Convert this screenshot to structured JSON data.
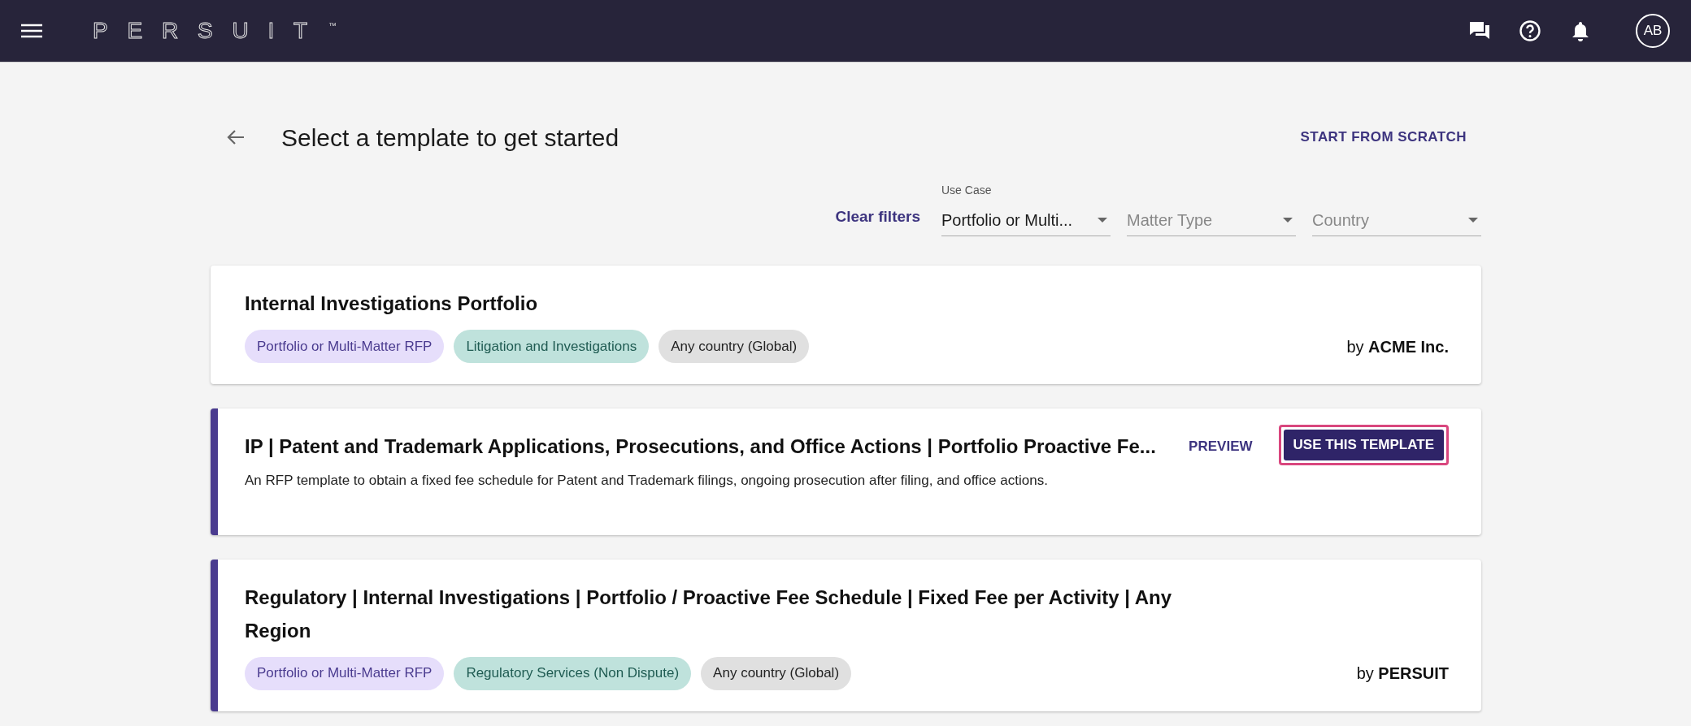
{
  "header": {
    "logo": "PERSUIT",
    "logo_mark": "™",
    "avatar": "AB"
  },
  "page": {
    "title": "Select a template to get started",
    "start_button": "START FROM SCRATCH"
  },
  "filters": {
    "clear": "Clear filters",
    "fields": [
      {
        "label": "Use Case",
        "value": "Portfolio or Multi..."
      },
      {
        "placeholder": "Matter Type"
      },
      {
        "placeholder": "Country"
      }
    ]
  },
  "templates": [
    {
      "title": "Internal Investigations Portfolio",
      "accent": false,
      "tags": [
        {
          "label": "Portfolio or Multi-Matter RFP",
          "kind": "use_case",
          "color": "#e6defb"
        },
        {
          "label": "Litigation and Investigations",
          "kind": "practice",
          "color": "#bfe2dc"
        },
        {
          "label": "Any country (Global)",
          "kind": "country",
          "color": "#e0e0e0"
        }
      ],
      "author": "by **ACME Inc.**"
    },
    {
      "title": "IP | Patent and Trademark Applications, Prosecutions, and Office Actions | Portfolio Proactive Fe...",
      "accent": true,
      "description": "An RFP template to obtain a fixed fee schedule for Patent and Trademark filings, ongoing prosecution after filing, and office actions.",
      "preview": "PREVIEW",
      "use": "USE THIS TEMPLATE",
      "focused": true
    },
    {
      "title": "Regulatory | Internal Investigations | Portfolio / Proactive Fee Schedule | Fixed Fee per Activity | Any Region",
      "accent": true,
      "tags": [
        {
          "label": "Portfolio or Multi-Matter RFP",
          "kind": "use_case",
          "color": "#e6defb"
        },
        {
          "label": "Regulatory Services (Non Dispute)",
          "kind": "practice",
          "color": "#bfe2dc"
        },
        {
          "label": "Any country (Global)",
          "kind": "country",
          "color": "#e0e0e0"
        }
      ],
      "author": "by **PERSUIT**"
    }
  ]
}
